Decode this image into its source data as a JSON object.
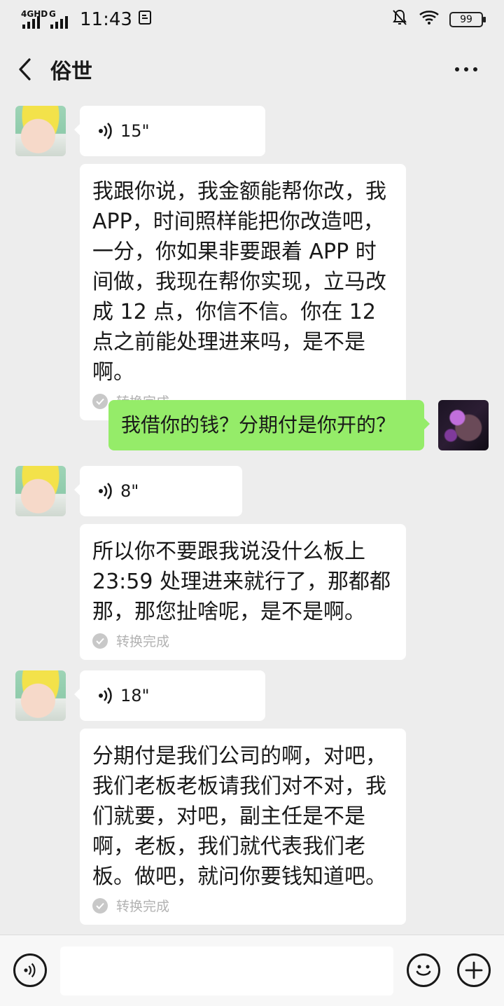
{
  "status_bar": {
    "network_primary": "4GHD",
    "network_secondary": "G",
    "time": "11:43",
    "battery": "99",
    "icons": [
      "signal-icon",
      "sim-icon",
      "mute-icon",
      "wifi-icon",
      "battery-icon"
    ]
  },
  "header": {
    "title": "俗世",
    "back_icon": "chevron-left-icon",
    "more_icon": "more-dots-icon"
  },
  "messages": [
    {
      "side": "left",
      "type": "voice",
      "duration": "15\""
    },
    {
      "side": "left",
      "type": "transcript",
      "text": "我跟你说，我金额能帮你改，我APP，时间照样能把你改造吧，一分，你如果非要跟着 APP 时间做，我现在帮你实现，立马改成 12 点，你信不信。你在 12 点之前能处理进来吗，是不是啊。",
      "status": "转换完成"
    },
    {
      "side": "right",
      "type": "text",
      "text": "我借你的钱？分期付是你开的？"
    },
    {
      "side": "left",
      "type": "voice",
      "duration": "8\""
    },
    {
      "side": "left",
      "type": "transcript",
      "text": "所以你不要跟我说没什么板上 23:59 处理进来就行了，那都都那，那您扯啥呢，是不是啊。",
      "status": "转换完成"
    },
    {
      "side": "left",
      "type": "voice",
      "duration": "18\""
    },
    {
      "side": "left",
      "type": "transcript",
      "text": "分期付是我们公司的啊，对吧，我们老板老板请我们对不对，我们就要，对吧，副主任是不是啊，老板，我们就代表我们老板。做吧，就问你要钱知道吧。",
      "status": "转换完成"
    }
  ],
  "input_bar": {
    "voice_icon": "voice-input-icon",
    "input_value": "",
    "emoji_icon": "emoji-icon",
    "plus_icon": "plus-icon"
  },
  "colors": {
    "background": "#ededed",
    "bubble_left": "#ffffff",
    "bubble_right": "#95ec69",
    "status_text": "#b2b2b2"
  }
}
